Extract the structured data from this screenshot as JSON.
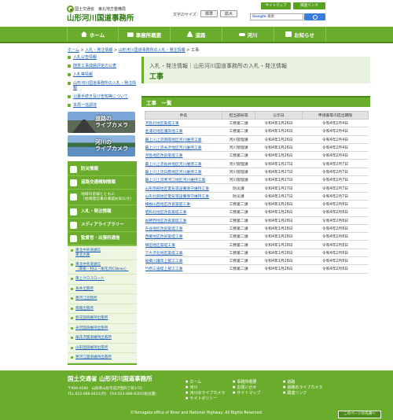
{
  "header": {
    "org_line": "国土交通省　東北地方整備局",
    "site_title": "山形河川国道事務所",
    "sitemap_label": "サイトマップ",
    "links_label": "関連リンク",
    "font_size_label": "文字のサイズ：",
    "font_standard": "標準",
    "font_large": "拡大",
    "search_placeholder": "Google 検索",
    "search_brand": "Google"
  },
  "nav": [
    "ホーム",
    "事務所概要",
    "道路",
    "河川",
    "お知らせ"
  ],
  "breadcrumb": {
    "items": [
      "ホーム",
      "入札・発注情報",
      "山形河川国道事務所の入札・発注情報"
    ],
    "separator": ">",
    "current": "工事"
  },
  "sidebar": {
    "links": [
      "入札公告情報",
      "随意工事成績評定の公表",
      "入札等情報",
      "山形河川国道事務所の入札・発注情報",
      "公募手続き及び告知等について",
      "本局一括調達"
    ],
    "road_camera": "道路の\nライブカメラ",
    "river_camera": "河川の\nライブカメラ",
    "menu": [
      "防災情報",
      "道路交通規制情報",
      "地域の皆様とともに\n（地域発信事の事前お知らせ）",
      "入札・発注情報",
      "メディアライブラリー",
      "監督官・出張所通信"
    ],
    "sub_items": [
      "東北中央道通信\n東北大路",
      "東北中央道通信\n（東根・村山・尾花沢ICNews）",
      "東上クロスロード",
      "長井出張所",
      "寒河江出張所",
      "南陽出張所",
      "新庄国道維持出張所",
      "米沢国道維持出張所",
      "尾花沢国道維持出張所",
      "山形国道維持出張所",
      "寒河江国道維持出張所"
    ]
  },
  "main": {
    "subtitle": "入札・発注情報｜山形河川国道事務所の入札・発注情報",
    "title": "工事",
    "section_heading": "工事　一覧",
    "columns": [
      "件名",
      "担当部局等",
      "公示日",
      "申請書等の提出期限"
    ],
    "rows": [
      [
        "河島北地区築堤工事",
        "工務第二課",
        "令和4年1月26日",
        "令和4年2月4日"
      ],
      [
        "金浦北地区護岸他工事",
        "工務第二課",
        "令和4年1月26日",
        "令和4年2月4日"
      ],
      [
        "最上川上流南陽地区河川維持工事",
        "河川管理課",
        "令和4年1月26日",
        "令和4年2月4日"
      ],
      [
        "最上川上流米沢地区河川維持工事",
        "河川管理課",
        "令和4年1月26日",
        "令和4年2月4日"
      ],
      [
        "河島地区改良築堤工事",
        "工務第二課",
        "令和4年1月26日",
        "令和4年2月4日"
      ],
      [
        "最上川上流長井地区河川維持工事",
        "河川管理課",
        "令和4年1月27日",
        "令和4年2月7日"
      ],
      [
        "最上川上流白鷹地区河川維持工事",
        "河川管理課",
        "令和4年1月27日",
        "令和4年2月7日"
      ],
      [
        "最上川上流寒河江地区河川維持工事",
        "河川管理課",
        "令和4年1月27日",
        "令和4年2月7日"
      ],
      [
        "山形南部地区電気等設備保守維持工事",
        "防災課",
        "令和4年1月27日",
        "令和4年2月7日"
      ],
      [
        "山形北部地区電気等設備保守維持工事",
        "防災課",
        "令和4年1月27日",
        "令和4年2月7日"
      ],
      [
        "横根山西地区改良築堤工事",
        "工務第二課",
        "令和4年1月28日",
        "令和4年2月8日"
      ],
      [
        "昭和北地区改良築堤工事",
        "工務第二課",
        "令和4年1月28日",
        "令和4年2月8日"
      ],
      [
        "長野西地区改良築堤工事",
        "工務第二課",
        "令和4年1月28日",
        "令和4年2月8日"
      ],
      [
        "升谷地区改良築堤工事",
        "工務第二課",
        "令和4年1月28日",
        "令和4年2月8日"
      ],
      [
        "西郷地区改良築堤工事",
        "工務第二課",
        "令和4年1月28日",
        "令和4年2月8日"
      ],
      [
        "梯田地区築堤工事",
        "工務第二課",
        "令和4年1月28日",
        "令和4年2月8日"
      ],
      [
        "下大沢北地区築堤工事",
        "工務第二課",
        "令和4年1月28日",
        "令和4年2月8日"
      ],
      [
        "桜郷川護岸上部工工事",
        "工務第二課",
        "令和4年1月28日",
        "令和4年2月8日"
      ],
      [
        "竹原三道堤上部工工事",
        "工務第二課",
        "令和4年1月28日",
        "令和4年2月8日"
      ]
    ]
  },
  "footer": {
    "name": "国土交通省 山形河川国道事務所",
    "address": "〒990-9580　山形県山形市成沢西四丁目3-55",
    "tel": "TEL:023-688-8421(代)　FAX:023-688-8301(防災課)",
    "links_col1": [
      "ホーム",
      "河川",
      "河川のライブカメラ",
      "サイトポリシー"
    ],
    "links_col2": [
      "事務所概要",
      "お問い合せ",
      "サイトマップ"
    ],
    "links_col3": [
      "道路",
      "道路のライブカメラ",
      "関連リンク"
    ],
    "copyright": "©Yamagata office of River and National Highway, All Rights Reserved.",
    "to_top": "このページの先頭へ"
  }
}
